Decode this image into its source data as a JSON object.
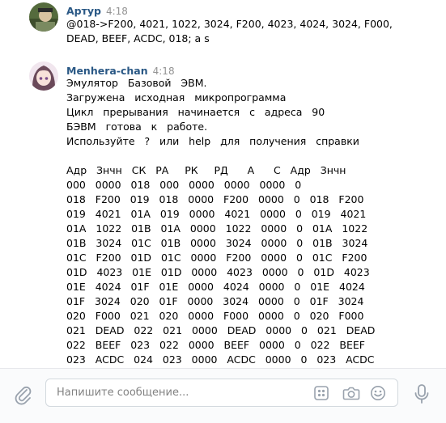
{
  "messages": [
    {
      "author": "Артур",
      "time": "4:18",
      "lines": [
        "@018->F200, 4021, 1022, 3024, F200, 4023, 4024, 3024, F000,",
        "DEAD, BEEF, ACDC, 018; a s"
      ]
    },
    {
      "author": "Menhera-chan",
      "time": "4:18",
      "lines": [
        "Эмулятор   Базовой   ЭВМ.",
        "Загружена   исходная   микропрограмма",
        "Цикл   прерывания   начинается   с   адреса   90",
        "БЭВМ   готова   к   работе.",
        "Используйте   ?   или   help   для   получения   справки",
        "",
        "Адр   Знчн   СК   РА     РК     РД      А      С   Адр   Знчн",
        "000   0000   018   000   0000   0000   0000   0",
        "018   F200   019   018   0000   F200   0000   0   018   F200",
        "019   4021   01A   019   0000   4021   0000   0   019   4021",
        "01A   1022   01B   01A   0000   1022   0000   0   01A   1022",
        "01B   3024   01C   01B   0000   3024   0000   0   01B   3024",
        "01C   F200   01D   01C   0000   F200   0000   0   01C   F200",
        "01D   4023   01E   01D   0000   4023   0000   0   01D   4023",
        "01E   4024   01F   01E   0000   4024   0000   0   01E   4024",
        "01F   3024   020   01F   0000   3024   0000   0   01F   3024",
        "020   F000   021   020   0000   F000   0000   0   020   F000",
        "021   DEAD   022   021   0000   DEAD   0000   0   021   DEAD",
        "022   BEEF   023   022   0000   BEEF   0000   0   022   BEEF",
        "023   ACDC   024   023   0000   ACDC   0000   0   023   ACDC"
      ]
    }
  ],
  "composer": {
    "placeholder": "Напишите сообщение..."
  },
  "icons": {
    "attach": "paperclip-icon",
    "template": "template-grid-icon",
    "camera": "camera-icon",
    "emoji": "smile-icon",
    "mic": "microphone-icon"
  },
  "colors": {
    "author": "#2a5885",
    "time": "#939393",
    "icon": "#99a2ad"
  }
}
